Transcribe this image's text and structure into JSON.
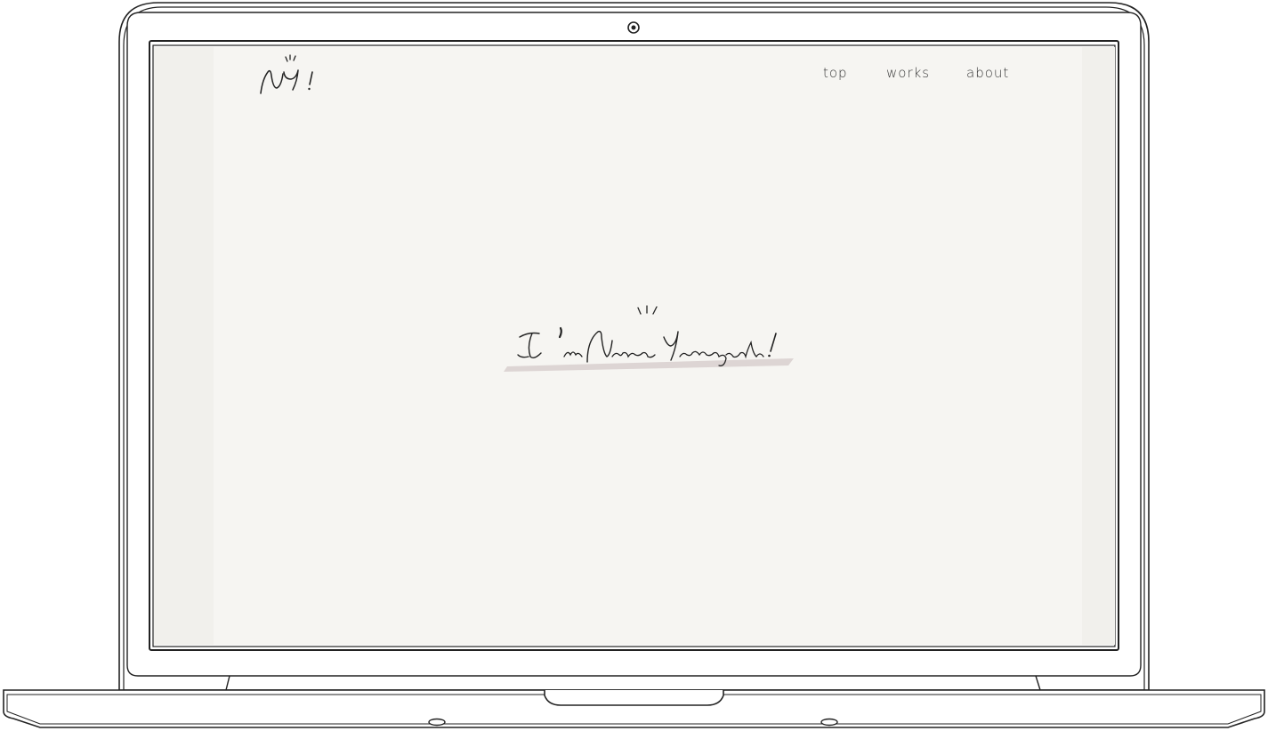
{
  "logo": {
    "text": "NY!",
    "icon": "signature-logo"
  },
  "nav": {
    "items": [
      {
        "label": "top"
      },
      {
        "label": "works"
      },
      {
        "label": "about"
      }
    ]
  },
  "hero": {
    "headline": "I'm Nana Yamaguchi!",
    "underline_color": "#ddd5d4"
  },
  "colors": {
    "screen_background": "#f6f5f2",
    "screen_margin": "#f1f0ec",
    "ink": "#222222"
  }
}
